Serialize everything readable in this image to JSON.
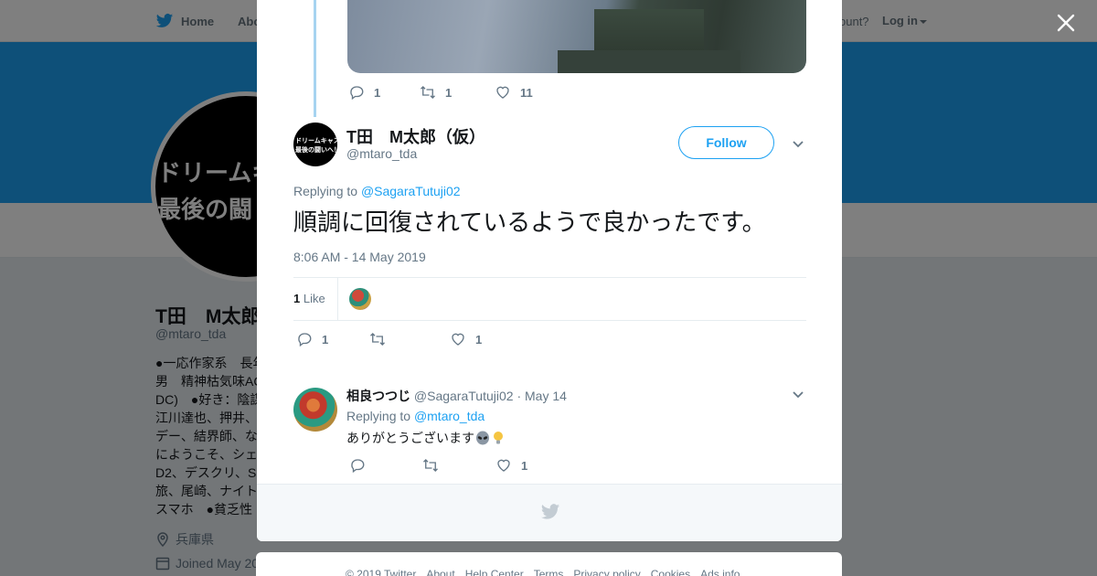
{
  "nav": {
    "home": "Home",
    "about": "Abo",
    "account_prompt": "ccount?",
    "login": "Log in"
  },
  "profile": {
    "avatar_line1": "ドリームキ",
    "avatar_line2": "最後の闘",
    "name": "T田　M太郎",
    "handle": "@mtaro_tda",
    "bio_lines": [
      "●一応作家系　長年",
      "男　精神枯気味AC",
      "DC)　●好き：陰謀",
      "江川達也、押井、",
      "デー、結界師、な",
      "にようこそ、シェ",
      "D2、デスクリ、S",
      "旅、尾崎、ナイト",
      "スマホ　●貧乏性"
    ],
    "location": "兵庫県",
    "joined": "Joined May 20"
  },
  "prev_tweet_actions": {
    "replies": "1",
    "retweets": "1",
    "likes": "11"
  },
  "tweet": {
    "avatar_line1": "ドリームキャスト",
    "avatar_line2": "最後の闘いへ！",
    "name": "T田　M太郎（仮）",
    "handle": "@mtaro_tda",
    "follow_label": "Follow",
    "replying_prefix": "Replying to ",
    "replying_to": "@SagaraTutuji02",
    "text": "順調に回復されているようで良かったです。",
    "timestamp": "8:06 AM - 14 May 2019",
    "like_count": "1",
    "like_label": "Like",
    "actions": {
      "replies": "1",
      "retweets": "",
      "likes": "1"
    }
  },
  "reply": {
    "name": "相良つつじ",
    "handle": "@SagaraTutuji02",
    "date": "May 14",
    "replying_prefix": "Replying to ",
    "replying_to": "@mtaro_tda",
    "text": "ありがとうございます",
    "emojis": [
      "alien-emoji",
      "lightbulb-emoji"
    ],
    "actions": {
      "replies": "",
      "retweets": "",
      "likes": "1"
    }
  },
  "footer_links": [
    "© 2019 Twitter",
    "About",
    "Help Center",
    "Terms",
    "Privacy policy",
    "Cookies",
    "Ads info"
  ],
  "colors": {
    "accent": "#1da1f2",
    "secondary_text": "#657786",
    "thread_line": "#a6d3f0"
  }
}
